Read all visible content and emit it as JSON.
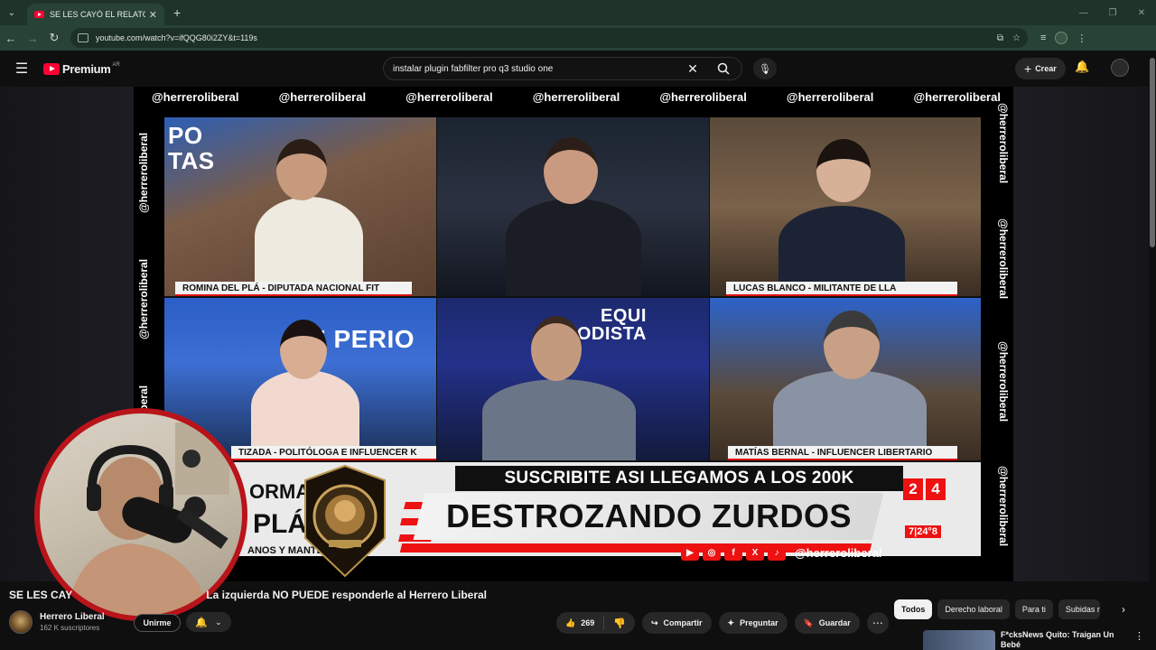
{
  "browser": {
    "tab_title": "SE LES CAYÓ EL RELATO EN VIV",
    "url": "youtube.com/watch?v=ifQQG80i2ZY&t=119s"
  },
  "youtube": {
    "logo_text": "Premium",
    "logo_region": "AR",
    "search_query": "instalar plugin fabfilter pro q3 studio one",
    "create_label": "Crear"
  },
  "video": {
    "watermark": "@herreroliberal",
    "sub_banner": "SUSCRIBITE ASI LLEGAMOS A LOS 200K",
    "main_banner": "DESTROZANDO ZURDOS",
    "social_handle": "@herreroliberal",
    "captions": {
      "top_left": "ROMINA DEL PLÁ - DIPUTADA NACIONAL FIT",
      "top_right": "LUCAS BLANCO - MILITANTE DE LLA",
      "bottom_left": "TIZADA - POLITÓLOGA E INFLUENCER K",
      "bottom_right": "MATÍAS BERNAL - INFLUENCER LIBERTARIO"
    },
    "studio_text_1": "PO\nTAS",
    "studio_text_2": "E PERIO",
    "studio_text_3": "EQUI\nDE ODISTA",
    "lower_left_1": "ORMA L",
    "lower_left_2": "PLÁ",
    "lower_left_3": "ANOS Y MANTE",
    "score": [
      "2",
      "4"
    ],
    "ticker_right": "7|24°8"
  },
  "below": {
    "title_start": "SE LES CAY",
    "title_end": "La izquierda NO PUEDE responderle al Herrero Liberal",
    "channel_name": "Herrero Liberal",
    "subscribers": "162 K suscriptores",
    "join_label": "Unirme",
    "likes": "269",
    "share_label": "Compartir",
    "ask_label": "Preguntar",
    "save_label": "Guardar"
  },
  "chips": [
    "Todos",
    "Derecho laboral",
    "Para ti",
    "Subidas r"
  ],
  "recommendation": {
    "title": "F*cksNews Quito: Traigan Un Bebé"
  }
}
